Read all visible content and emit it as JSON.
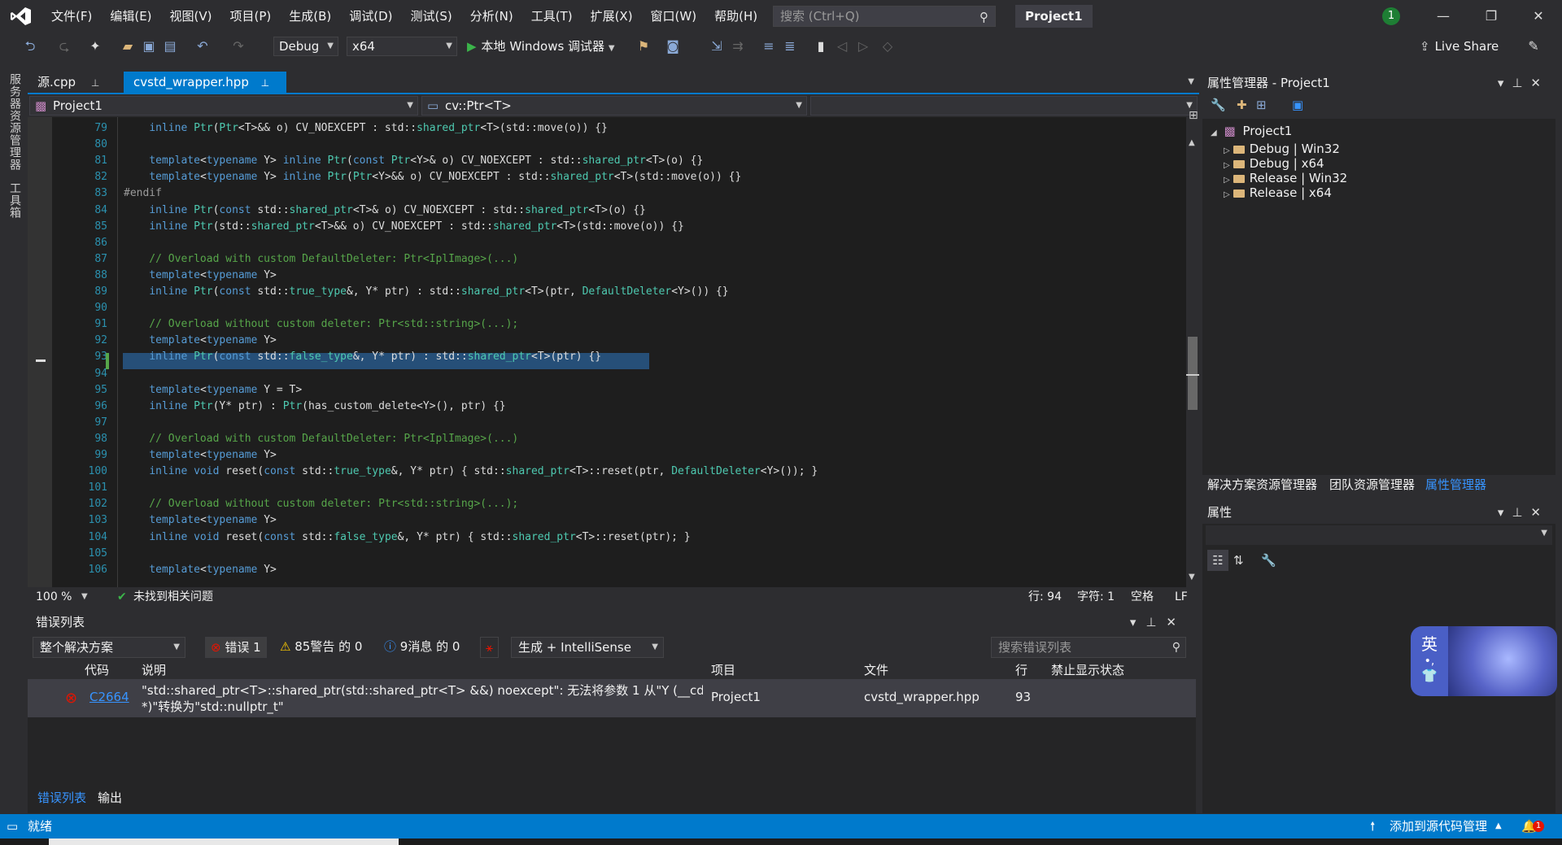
{
  "menu": {
    "items": [
      "文件(F)",
      "编辑(E)",
      "视图(V)",
      "项目(P)",
      "生成(B)",
      "调试(D)",
      "测试(S)",
      "分析(N)",
      "工具(T)",
      "扩展(X)",
      "窗口(W)",
      "帮助(H)"
    ],
    "search_placeholder": "搜索 (Ctrl+Q)",
    "project_title": "Project1",
    "notification_count": "1"
  },
  "toolbar": {
    "config": "Debug",
    "platform": "x64",
    "run_label": "本地 Windows 调试器",
    "live_share": "Live Share"
  },
  "left_strip": {
    "server_explorer": "服务器资源管理器",
    "toolbox": "工具箱"
  },
  "editor": {
    "tabs": [
      {
        "label": "源.cpp",
        "active": false
      },
      {
        "label": "cvstd_wrapper.hpp",
        "active": true
      }
    ],
    "nav_project": "Project1",
    "nav_scope": "cv::Ptr<T>",
    "line_numbers": [
      "79",
      "80",
      "81",
      "82",
      "83",
      "84",
      "85",
      "86",
      "87",
      "88",
      "89",
      "90",
      "91",
      "92",
      "93",
      "94",
      "95",
      "96",
      "97",
      "98",
      "99",
      "100",
      "101",
      "102",
      "103",
      "104",
      "105",
      "106"
    ],
    "lines": [
      "    inline Ptr(Ptr<T>&& o) CV_NOEXCEPT : std::shared_ptr<T>(std::move(o)) {}",
      "",
      "    template<typename Y> inline Ptr(const Ptr<Y>& o) CV_NOEXCEPT : std::shared_ptr<T>(o) {}",
      "    template<typename Y> inline Ptr(Ptr<Y>&& o) CV_NOEXCEPT : std::shared_ptr<T>(std::move(o)) {}",
      "#endif",
      "    inline Ptr(const std::shared_ptr<T>& o) CV_NOEXCEPT : std::shared_ptr<T>(o) {}",
      "    inline Ptr(std::shared_ptr<T>&& o) CV_NOEXCEPT : std::shared_ptr<T>(std::move(o)) {}",
      "",
      "    // Overload with custom DefaultDeleter: Ptr<IplImage>(...)",
      "    template<typename Y>",
      "    inline Ptr(const std::true_type&, Y* ptr) : std::shared_ptr<T>(ptr, DefaultDeleter<Y>()) {}",
      "",
      "    // Overload without custom deleter: Ptr<std::string>(...);",
      "    template<typename Y>",
      "    inline Ptr(const std::false_type&, Y* ptr) : std::shared_ptr<T>(ptr) {}",
      "",
      "    template<typename Y = T>",
      "    inline Ptr(Y* ptr) : Ptr(has_custom_delete<Y>(), ptr) {}",
      "",
      "    // Overload with custom DefaultDeleter: Ptr<IplImage>(...)",
      "    template<typename Y>",
      "    inline void reset(const std::true_type&, Y* ptr) { std::shared_ptr<T>::reset(ptr, DefaultDeleter<Y>()); }",
      "",
      "    // Overload without custom deleter: Ptr<std::string>(...);",
      "    template<typename Y>",
      "    inline void reset(const std::false_type&, Y* ptr) { std::shared_ptr<T>::reset(ptr); }",
      "",
      "    template<typename Y>"
    ],
    "zoom": "100 %",
    "issues": "未找到相关问题",
    "row": "行: 94",
    "col": "字符: 1",
    "spaces": "空格",
    "eol": "LF"
  },
  "error_list": {
    "title": "错误列表",
    "scope": "整个解决方案",
    "errors": "错误 1",
    "warnings": "85警告 的 0",
    "messages": "9消息 的 0",
    "build_filter": "生成 + IntelliSense",
    "search_placeholder": "搜索错误列表",
    "columns": [
      "代码",
      "说明",
      "项目",
      "文件",
      "行",
      "禁止显示状态"
    ],
    "rows": [
      {
        "code": "C2664",
        "desc_line1": "\"std::shared_ptr<T>::shared_ptr(std::shared_ptr<T> &&) noexcept\": 无法将参数 1 从\"Y (__cdecl",
        "desc_line2": "*)\"转换为\"std::nullptr_t\"",
        "project": "Project1",
        "file": "cvstd_wrapper.hpp",
        "line": "93"
      }
    ]
  },
  "bottom_tabs": [
    "错误列表",
    "输出"
  ],
  "property_manager": {
    "title": "属性管理器 - Project1",
    "root": "Project1",
    "items": [
      "Debug | Win32",
      "Debug | x64",
      "Release | Win32",
      "Release | x64"
    ]
  },
  "right_tabs": [
    "解决方案资源管理器",
    "团队资源管理器",
    "属性管理器"
  ],
  "properties_title": "属性",
  "ime": {
    "lang": "英"
  },
  "statusbar": {
    "ready": "就绪",
    "source_control": "添加到源代码管理",
    "badge": "1"
  },
  "colors": {
    "accent": "#007acc",
    "editor_bg": "#1e1e1e",
    "selection": "#264f78",
    "error": "#e51400"
  }
}
